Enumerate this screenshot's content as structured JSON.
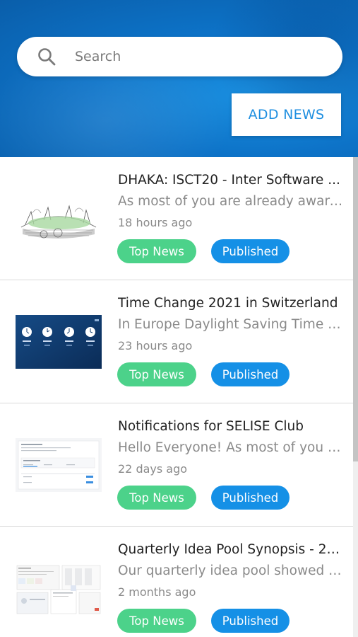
{
  "search": {
    "placeholder": "Search",
    "icon": "search-icon"
  },
  "header": {
    "add_news_label": "ADD NEWS"
  },
  "colors": {
    "accent": "#1f8fe0",
    "top_news_badge": "#4cd28a",
    "published_badge": "#1590e6"
  },
  "news": [
    {
      "title": "DHAKA: ISCT20 - Inter Software ...",
      "excerpt": "As most of you are already aware,...",
      "time": "18 hours ago",
      "category": "Top News",
      "status": "Published",
      "thumbnail": "cricket-stadium-sketch"
    },
    {
      "title": "Time Change 2021 in Switzerland",
      "excerpt": "In Europe Daylight Saving Time En...",
      "time": "23 hours ago",
      "category": "Top News",
      "status": "Published",
      "thumbnail": "world-clocks"
    },
    {
      "title": "Notifications for SELISE Club",
      "excerpt": "Hello Everyone! As most of you ar...",
      "time": "22 days ago",
      "category": "Top News",
      "status": "Published",
      "thumbnail": "settings-screenshot"
    },
    {
      "title": "Quarterly Idea Pool Synopsis - 23....",
      "excerpt": "Our quarterly idea pool showed o...",
      "time": "2 months ago",
      "category": "Top News",
      "status": "Published",
      "thumbnail": "screens-collage"
    }
  ]
}
